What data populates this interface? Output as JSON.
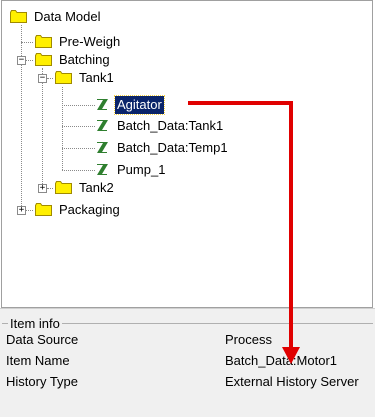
{
  "tree": {
    "root": {
      "label": "Data Model"
    },
    "pre_weigh": {
      "label": "Pre-Weigh"
    },
    "batching": {
      "label": "Batching"
    },
    "tank1": {
      "label": "Tank1"
    },
    "agitator": {
      "label": "Agitator"
    },
    "batch_tank1": {
      "label": "Batch_Data:Tank1"
    },
    "batch_temp1": {
      "label": "Batch_Data:Temp1"
    },
    "pump1": {
      "label": "Pump_1"
    },
    "tank2": {
      "label": "Tank2"
    },
    "packaging": {
      "label": "Packaging"
    }
  },
  "item_info": {
    "legend": "Item info",
    "rows": [
      {
        "key": "Data Source",
        "value": "Process"
      },
      {
        "key": "Item Name",
        "value": "Batch_Data:Motor1"
      },
      {
        "key": "History Type",
        "value": "External History Server"
      }
    ]
  },
  "colors": {
    "folder_fill": "#ffef00",
    "folder_stroke": "#a08a00",
    "selection_bg": "#0a246a",
    "arrow": "#e00000",
    "tag_green": "#2f7f2f"
  },
  "icons": {
    "folder": "folder-icon",
    "tag": "process-tag-icon",
    "expand": "plus-box-icon",
    "collapse": "minus-box-icon"
  }
}
